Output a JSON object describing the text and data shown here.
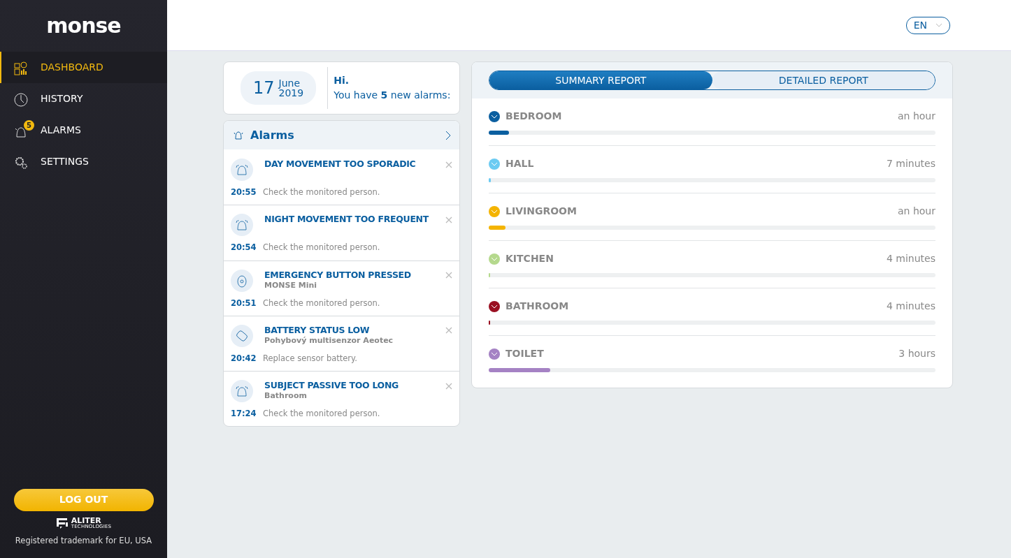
{
  "sidebar": {
    "logo": "monse",
    "items": [
      {
        "label": "DASHBOARD",
        "selected": true
      },
      {
        "label": "HISTORY",
        "selected": false
      },
      {
        "label": "ALARMS",
        "selected": false,
        "badge": "5"
      },
      {
        "label": "SETTINGS",
        "selected": false
      }
    ],
    "logout": "LOG OUT",
    "brand": {
      "name": "ALITER",
      "sub": "TECHNOLOGIES"
    },
    "footer": "Registered trademark for EU, USA"
  },
  "header": {
    "language": "EN"
  },
  "date": {
    "day": "17",
    "month": "June",
    "year": "2019"
  },
  "greeting": {
    "hi": "Hi.",
    "message": "You have **5** new alarms:"
  },
  "alarms": {
    "title": "Alarms",
    "items": [
      {
        "kind": "bell",
        "title": "DAY MOVEMENT TOO SPORADIC",
        "time": "20:55",
        "note": "Check the monitored person."
      },
      {
        "kind": "bell",
        "title": "NIGHT MOVEMENT TOO FREQUENT",
        "time": "20:54",
        "note": "Check the monitored person."
      },
      {
        "kind": "button",
        "title": "EMERGENCY BUTTON PRESSED",
        "source": "MONSE Mini",
        "time": "20:51",
        "note": "Check the monitored person."
      },
      {
        "kind": "sensor",
        "title": "BATTERY STATUS LOW",
        "source": "Pohybový multisenzor Aeotec",
        "time": "20:42",
        "note": "Replace sensor battery."
      },
      {
        "kind": "bell",
        "title": "SUBJECT PASSIVE TOO LONG",
        "source": "Bathroom",
        "time": "17:24",
        "note": "Check the monitored person."
      }
    ]
  },
  "report": {
    "tabs": [
      {
        "label": "SUMMARY REPORT",
        "selected": true
      },
      {
        "label": "DETAILED REPORT",
        "selected": false
      }
    ],
    "rooms": [
      {
        "name": "BEDROOM",
        "duration": "an hour",
        "color": "#0b5fa0",
        "level": 0.045
      },
      {
        "name": "HALL",
        "duration": "7 minutes",
        "color": "#6ccbf2",
        "level": 0.004
      },
      {
        "name": "LIVINGROOM",
        "duration": "an hour",
        "color": "#f4b400",
        "level": 0.038
      },
      {
        "name": "KITCHEN",
        "duration": "4 minutes",
        "color": "#b5d98d",
        "level": 0.002
      },
      {
        "name": "BATHROOM",
        "duration": "4 minutes",
        "color": "#9a1022",
        "level": 0.003
      },
      {
        "name": "TOILET",
        "duration": "3 hours",
        "color": "#a582c4",
        "level": 0.138
      }
    ]
  }
}
